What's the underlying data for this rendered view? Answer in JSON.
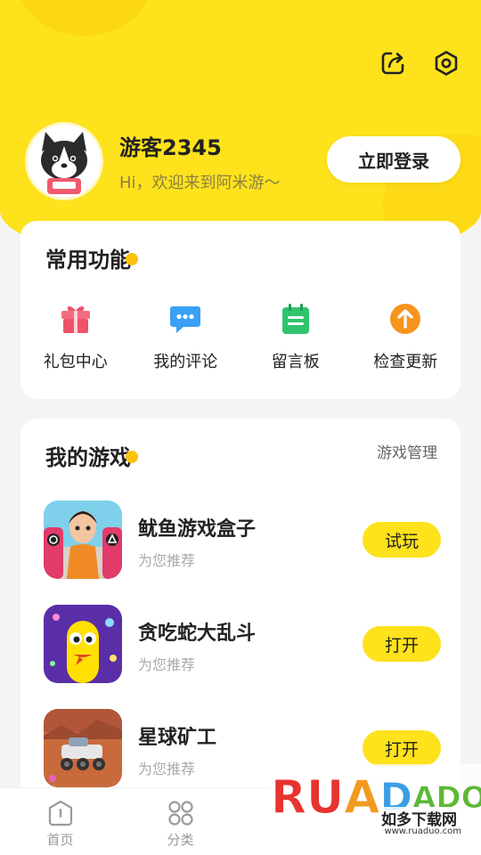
{
  "colors": {
    "brand_yellow": "#fde21c",
    "accent_orange": "#fbc20c"
  },
  "header": {
    "icons": [
      "share-edit-icon",
      "settings-hexagon-icon"
    ],
    "username": "游客2345",
    "greeting": "Hi，欢迎来到阿米游～",
    "login_label": "立即登录"
  },
  "functions": {
    "title": "常用功能",
    "items": [
      {
        "label": "礼包中心",
        "icon": "gift-icon",
        "color": "#f0526a"
      },
      {
        "label": "我的评论",
        "icon": "comment-bubble-icon",
        "color": "#3aa0f5"
      },
      {
        "label": "留言板",
        "icon": "notebook-icon",
        "color": "#2fc46e"
      },
      {
        "label": "检查更新",
        "icon": "update-arrow-icon",
        "color": "#f7941d"
      }
    ]
  },
  "games": {
    "title": "我的游戏",
    "manage_label": "游戏管理",
    "items": [
      {
        "name": "鱿鱼游戏盒子",
        "sub": "为您推荐",
        "action": "试玩"
      },
      {
        "name": "贪吃蛇大乱斗",
        "sub": "为您推荐",
        "action": "打开"
      },
      {
        "name": "星球矿工",
        "sub": "为您推荐",
        "action": "打开"
      }
    ]
  },
  "tabbar": {
    "items": [
      {
        "label": "首页",
        "icon": "home-icon"
      },
      {
        "label": "分类",
        "icon": "grid-icon"
      }
    ]
  },
  "watermark": {
    "letters": [
      "R",
      "U",
      "A",
      "D",
      "A",
      "D",
      "O"
    ],
    "cn": "如多下载网",
    "url": "www.ruaduo.com"
  }
}
